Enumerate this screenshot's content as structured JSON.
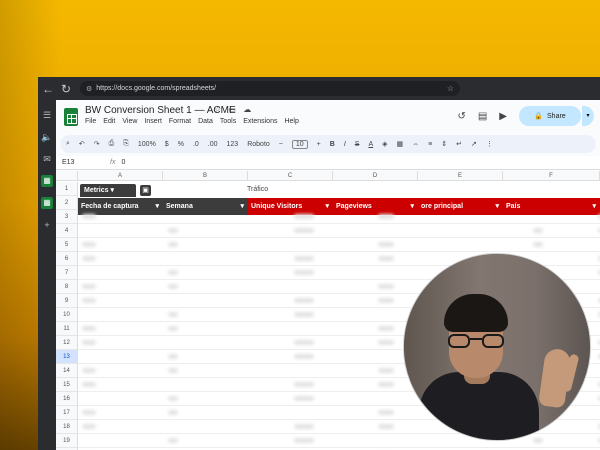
{
  "browser": {
    "url": "https://docs.google.com/spreadsheets/",
    "back_icon": "arrow-left-icon",
    "reload_icon": "reload-icon"
  },
  "sheet": {
    "title": "BW Conversion Sheet 1 — ACME",
    "menu": [
      "File",
      "Edit",
      "View",
      "Insert",
      "Format",
      "Data",
      "Tools",
      "Extensions",
      "Help"
    ],
    "share_label": "Share",
    "toolbar": {
      "zoom": "100%",
      "currency": "$",
      "percent": "%",
      "decimal_less": ".0",
      "decimal_more": ".00",
      "number_format": "123",
      "font": "Roboto",
      "font_size": "10",
      "bold": "B",
      "italic": "I",
      "strike": "S",
      "text_color": "A"
    },
    "namebox": "E13",
    "formula_value": "0",
    "columns": [
      "A",
      "B",
      "C",
      "D",
      "E",
      "F"
    ],
    "pill_label": "Metrics",
    "group_label": "Tráfico",
    "headers": [
      {
        "label": "Fecha de captura",
        "color": "#3c3c3c"
      },
      {
        "label": "Semana",
        "color": "#3c3c3c"
      },
      {
        "label": "Unique Visitors",
        "color": "#cc0000"
      },
      {
        "label": "Pageviews",
        "color": "#cc0000"
      },
      {
        "label": "ore principal",
        "color": "#cc0000"
      },
      {
        "label": "País",
        "color": "#cc0000"
      }
    ],
    "row_numbers": [
      "1",
      "2",
      "3",
      "4",
      "5",
      "6",
      "7",
      "8",
      "9",
      "10",
      "11",
      "12",
      "13",
      "14",
      "15",
      "16",
      "17",
      "18",
      "19",
      "20"
    ],
    "selected_row": "13"
  },
  "colors": {
    "accent_red": "#cc0000",
    "accent_dark": "#3c3c3c",
    "sheets_green": "#188038",
    "share_blue": "#c2e7ff"
  }
}
